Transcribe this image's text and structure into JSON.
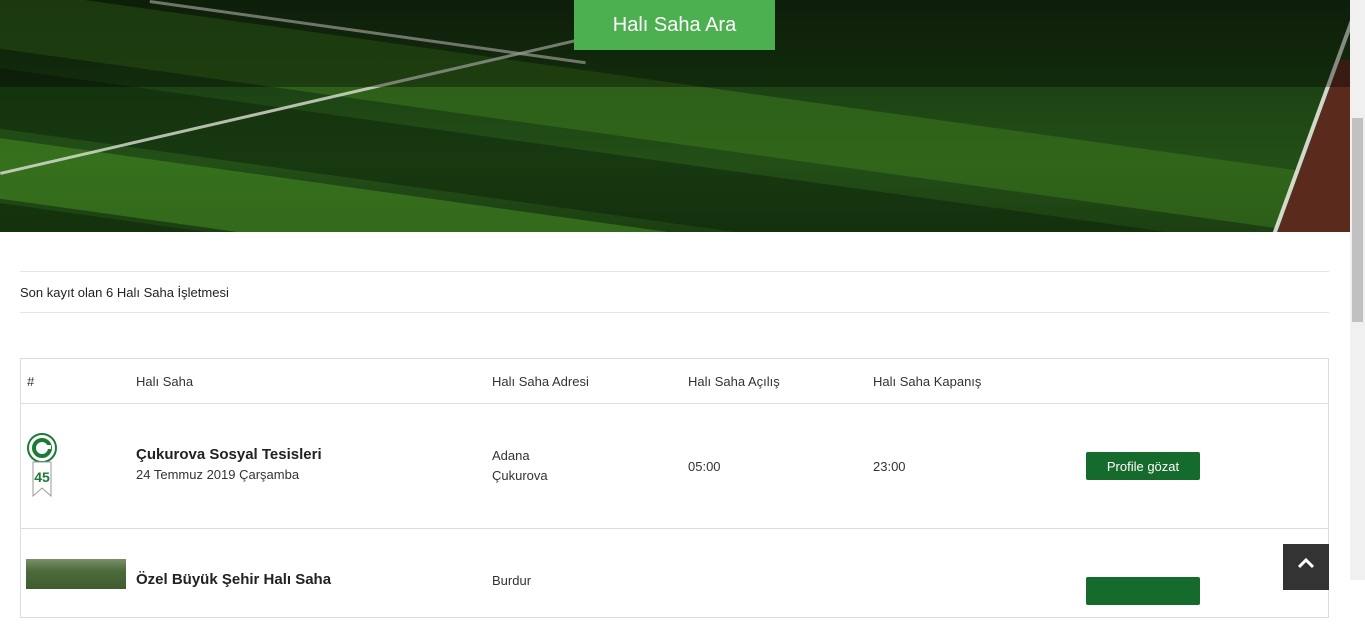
{
  "hero": {
    "search_button": "Halı Saha Ara"
  },
  "summary": {
    "text": "Son kayıt olan 6 Halı Saha İşletmesi"
  },
  "table": {
    "headers": [
      "#",
      "Halı Saha",
      "Halı Saha Adresi",
      "Halı Saha Açılış",
      "Halı Saha Kapanış"
    ],
    "rows": [
      {
        "name": "Çukurova Sosyal Tesisleri",
        "date": "24 Temmuz 2019 Çarşamba",
        "city": "Adana",
        "district": "Çukurova",
        "open": "05:00",
        "close": "23:00",
        "button": "Profile gözat",
        "image": "university-logo"
      },
      {
        "name": "Özel Büyük Şehir Halı Saha",
        "date": "",
        "city": "Burdur",
        "district": "",
        "open": "",
        "close": "",
        "button": "",
        "image": "field-thumbnail"
      }
    ]
  },
  "icons": {
    "scroll_top": "chevron-up-icon"
  },
  "colors": {
    "search_button": "#4caf50",
    "profile_button": "#146b2b",
    "scroll_top_bg": "#333333"
  }
}
